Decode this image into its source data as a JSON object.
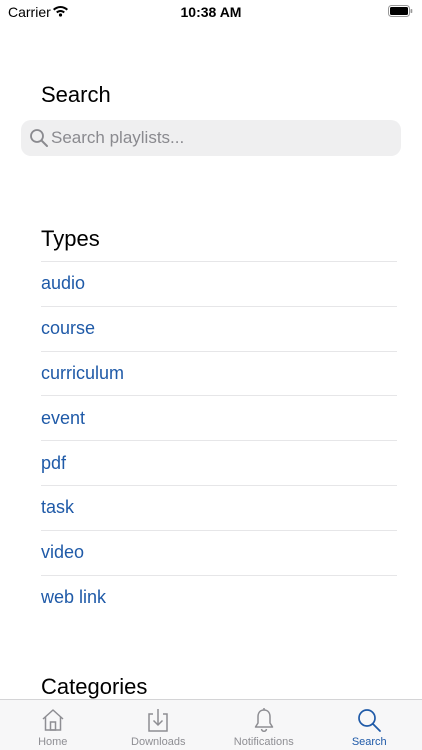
{
  "status_bar": {
    "carrier": "Carrier",
    "time": "10:38 AM"
  },
  "search": {
    "title": "Search",
    "placeholder": "Search playlists..."
  },
  "types": {
    "title": "Types",
    "items": [
      "audio",
      "course",
      "curriculum",
      "event",
      "pdf",
      "task",
      "video",
      "web link"
    ]
  },
  "categories": {
    "title": "Categories"
  },
  "tab_bar": {
    "tabs": [
      {
        "label": "Home",
        "icon": "home-icon"
      },
      {
        "label": "Downloads",
        "icon": "download-icon"
      },
      {
        "label": "Notifications",
        "icon": "bell-icon"
      },
      {
        "label": "Search",
        "icon": "search-icon"
      }
    ],
    "active": "Search"
  },
  "colors": {
    "accent": "#1f5aa8",
    "inactive": "#8e8e93",
    "search_field_bg": "#efeff0"
  }
}
